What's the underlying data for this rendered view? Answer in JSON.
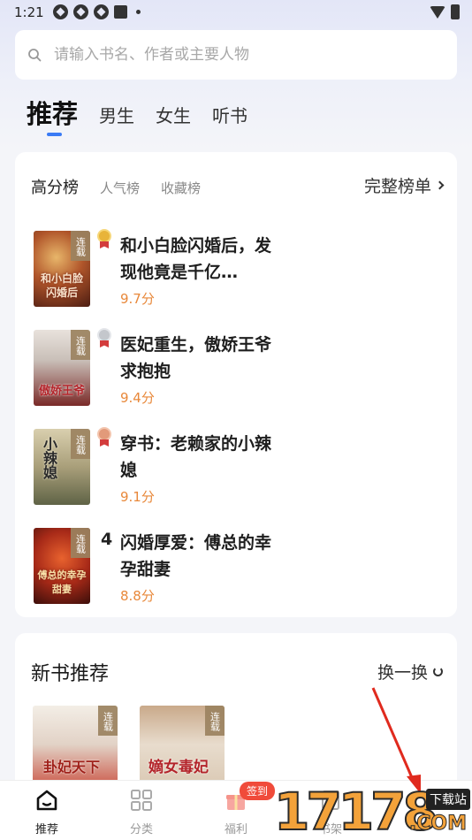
{
  "status_bar": {
    "time": "1:21"
  },
  "search": {
    "placeholder": "请输入书名、作者或主要人物"
  },
  "tabs": [
    {
      "label": "推荐",
      "active": true
    },
    {
      "label": "男生"
    },
    {
      "label": "女生"
    },
    {
      "label": "听书"
    }
  ],
  "ranking": {
    "tabs": [
      {
        "label": "高分榜",
        "active": true
      },
      {
        "label": "人气榜"
      },
      {
        "label": "收藏榜"
      }
    ],
    "full_list_label": "完整榜单",
    "books": [
      {
        "rank": "1",
        "medal": "gold",
        "title": "和小白脸闪婚后，发现他竟是千亿…",
        "score": "9.7分",
        "badge": "连载",
        "cover_text": "和小白脸闪婚后"
      },
      {
        "rank": "2",
        "medal": "silver",
        "title": "医妃重生，傲娇王爷求抱抱",
        "score": "9.4分",
        "badge": "连载",
        "cover_text": "傲娇王爷"
      },
      {
        "rank": "3",
        "medal": "bronze",
        "title": "穿书：老赖家的小辣媳",
        "score": "9.1分",
        "badge": "连载",
        "cover_text": "小辣媳"
      },
      {
        "rank": "4",
        "medal": "none",
        "title": "闪婚厚爱：傅总的幸孕甜妻",
        "score": "8.8分",
        "badge": "连载",
        "cover_text": "傅总的幸孕甜妻"
      }
    ]
  },
  "new_books": {
    "title": "新书推荐",
    "refresh_label": "换一换",
    "covers": [
      {
        "badge": "连载",
        "cover_text": "卦妃天下"
      },
      {
        "badge": "连载",
        "cover_text": "嫡女毒妃"
      }
    ]
  },
  "bottom_nav": {
    "items": [
      {
        "label": "推荐",
        "icon": "home-icon",
        "active": true
      },
      {
        "label": "分类",
        "icon": "grid-icon"
      },
      {
        "label": "福利",
        "icon": "gift-icon"
      },
      {
        "label": "书架",
        "icon": "bookshelf-icon"
      }
    ],
    "sign_badge": "签到"
  },
  "watermark": {
    "number": "17178",
    "box_text": "下载站",
    "suffix": ".COM"
  },
  "colors": {
    "accent": "#3a7bf5",
    "score": "#e8883a",
    "badge": "#f04b3a"
  }
}
